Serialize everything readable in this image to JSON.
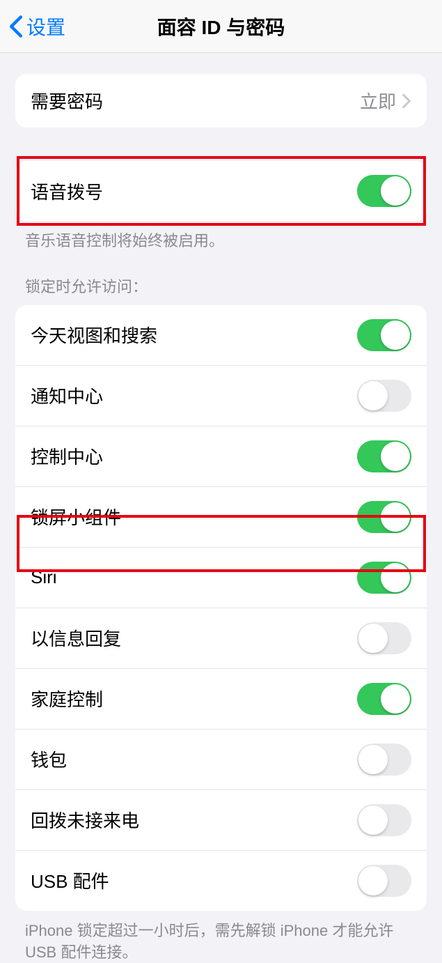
{
  "nav": {
    "back": "设置",
    "title": "面容 ID 与密码"
  },
  "requirePasscode": {
    "label": "需要密码",
    "value": "立即"
  },
  "voiceDial": {
    "label": "语音拨号",
    "on": true,
    "footer": "音乐语音控制将始终被启用。"
  },
  "lockAccess": {
    "header": "锁定时允许访问：",
    "items": [
      {
        "label": "今天视图和搜索",
        "on": true
      },
      {
        "label": "通知中心",
        "on": false
      },
      {
        "label": "控制中心",
        "on": true
      },
      {
        "label": "锁屏小组件",
        "on": true
      },
      {
        "label": "Siri",
        "on": true
      },
      {
        "label": "以信息回复",
        "on": false
      },
      {
        "label": "家庭控制",
        "on": true
      },
      {
        "label": "钱包",
        "on": false
      },
      {
        "label": "回拨未接来电",
        "on": false
      },
      {
        "label": "USB 配件",
        "on": false
      }
    ],
    "footer": "iPhone 锁定超过一小时后，需先解锁 iPhone 才能允许 USB 配件连接。"
  }
}
